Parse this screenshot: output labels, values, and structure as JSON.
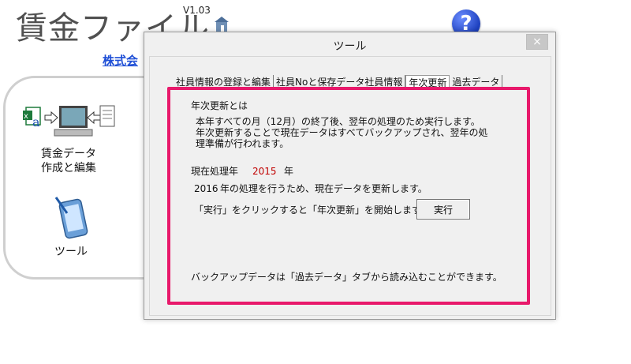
{
  "app": {
    "title": "賃金ファイル",
    "version": "V1.03",
    "company_link": "株式会",
    "help_label": "?",
    "menu": [
      {
        "line1": "賃金データ",
        "line2": "作成と編集",
        "icon": "wage-data-icon"
      },
      {
        "label": "ツール",
        "icon": "tablet-pen-icon"
      }
    ]
  },
  "dialog": {
    "title": "ツール",
    "close_label": "×",
    "tabs": [
      {
        "label": "社員情報の登録と編集"
      },
      {
        "label": "社員Noと保存データ社員情報"
      },
      {
        "label": "年次更新",
        "active": true
      },
      {
        "label": "過去データ"
      }
    ],
    "annual_update": {
      "heading": "年次更新とは",
      "desc_1": "本年すべての月（12月）の終了後、翌年の処理のため実行します。",
      "desc_2": "年次更新することで現在データはすべてバックアップされ、翌年の処",
      "desc_3": "理準備が行われます。",
      "current_year_label": "現在処理年",
      "current_year_value": "2015",
      "year_suffix": "年",
      "next_year_prefix": "2016",
      "next_year_text": "年の処理を行うため、現在データを更新します。",
      "instruction": "「実行」をクリックすると「年次更新」を開始します。",
      "execute_label": "実行",
      "backup_note": "バックアップデータは「過去データ」タブから読み込むことができます。",
      "highlight_color": "#e8196b"
    }
  }
}
